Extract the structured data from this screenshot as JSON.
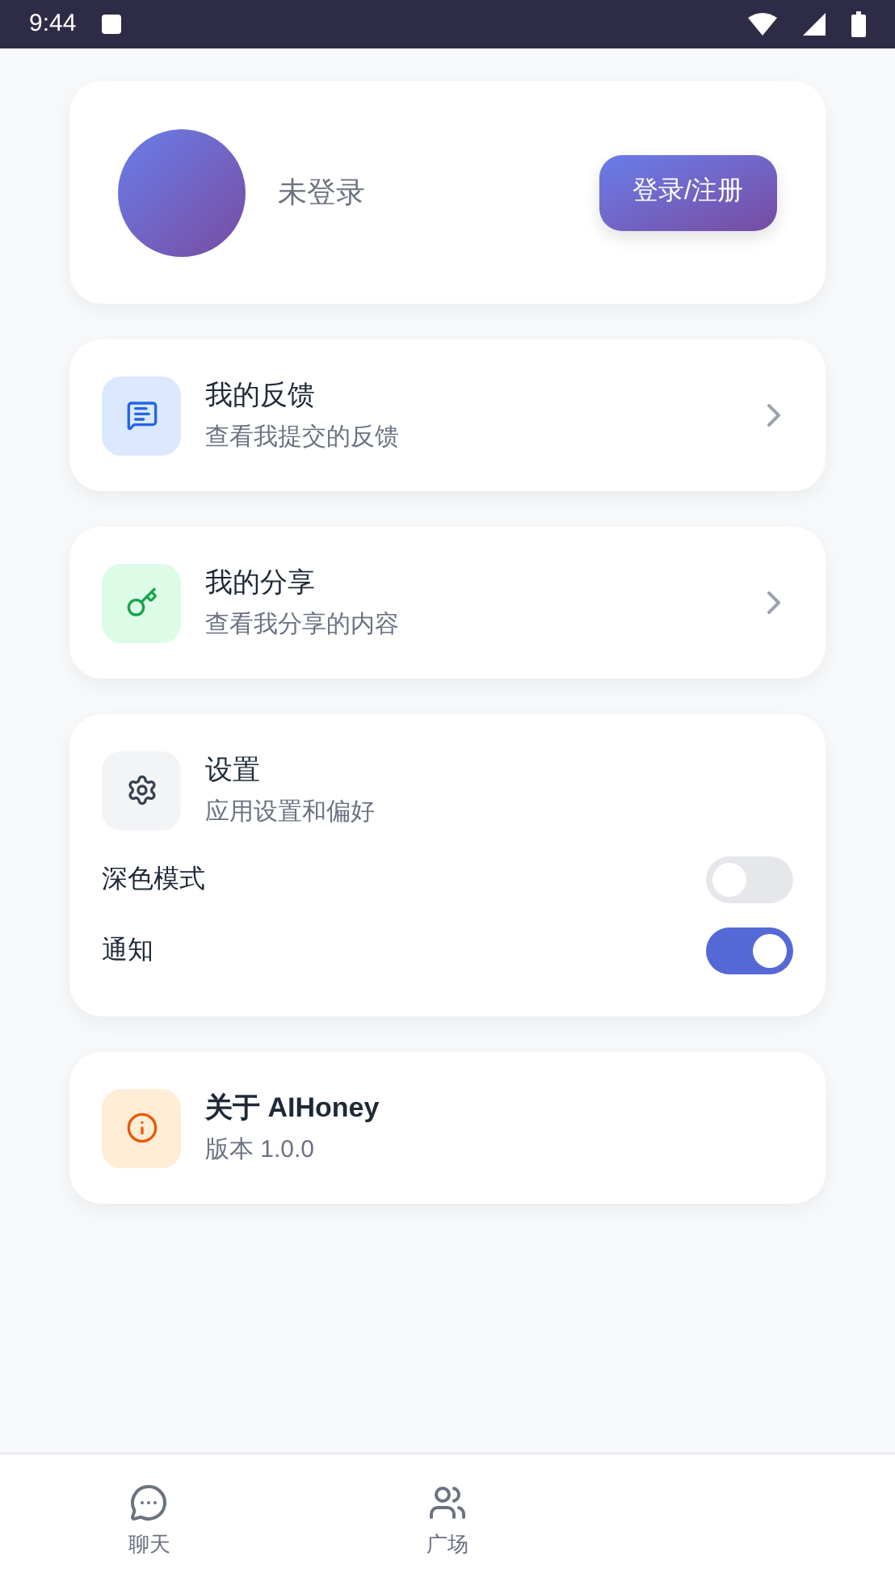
{
  "status_bar": {
    "time": "9:44"
  },
  "profile": {
    "name": "未登录",
    "login_button": "登录/注册"
  },
  "menu_items": [
    {
      "kind": "feedback",
      "title": "我的反馈",
      "subtitle": "查看我提交的反馈"
    },
    {
      "kind": "share",
      "title": "我的分享",
      "subtitle": "查看我分享的内容"
    }
  ],
  "settings": {
    "title": "设置",
    "subtitle": "应用设置和偏好",
    "toggles": [
      {
        "label": "深色模式",
        "on": false
      },
      {
        "label": "通知",
        "on": true
      }
    ]
  },
  "about": {
    "title": "关于 AIHoney",
    "version": "版本 1.0.0"
  },
  "bottom_nav": [
    {
      "kind": "chat",
      "label": "聊天",
      "selected": false
    },
    {
      "kind": "plaza",
      "label": "广场",
      "selected": false
    }
  ]
}
